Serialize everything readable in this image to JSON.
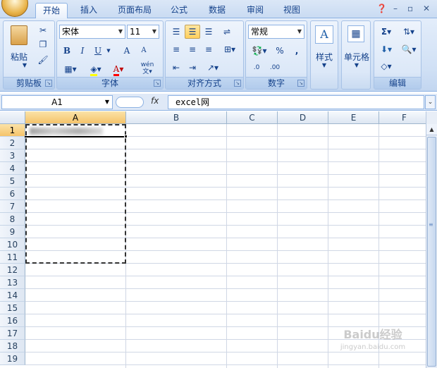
{
  "tabs": [
    "开始",
    "插入",
    "页面布局",
    "公式",
    "数据",
    "审阅",
    "视图"
  ],
  "active_tab": "开始",
  "ribbon": {
    "clipboard": {
      "label": "剪贴板",
      "paste": "粘贴"
    },
    "font": {
      "label": "字体",
      "font_name": "宋体",
      "font_size": "11",
      "bold": "B",
      "italic": "I",
      "underline": "U",
      "grow": "A",
      "shrink": "A",
      "phonetic": "wén"
    },
    "alignment": {
      "label": "对齐方式"
    },
    "number": {
      "label": "数字",
      "format": "常规",
      "percent": "%",
      "comma": ",",
      "inc_decimal": ".0",
      "dec_decimal": ".00"
    },
    "styles": {
      "label": "样式"
    },
    "cells": {
      "label": "单元格"
    },
    "editing": {
      "label": "编辑",
      "sum": "Σ"
    }
  },
  "formula_bar": {
    "name_box": "A1",
    "fx": "fx",
    "content": "excel网"
  },
  "columns": [
    "A",
    "B",
    "C",
    "D",
    "E",
    "F"
  ],
  "rows": [
    "1",
    "2",
    "3",
    "4",
    "5",
    "6",
    "7",
    "8",
    "9",
    "10",
    "11",
    "12",
    "13",
    "14",
    "15",
    "16",
    "17",
    "18",
    "19"
  ],
  "watermark": {
    "text": "Baidu经验",
    "sub": "jingyan.baidu.com"
  },
  "colors": {
    "ribbon_bg": "#d0e0f5",
    "accent": "#15428b",
    "selected_header": "#f5c36a"
  }
}
